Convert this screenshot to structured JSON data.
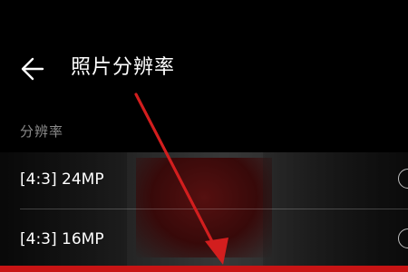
{
  "header": {
    "title": "照片分辨率",
    "back_icon": "arrow-left-icon"
  },
  "section": {
    "label": "分辨率"
  },
  "options": [
    {
      "label": "[4:3] 24MP",
      "selected": false
    },
    {
      "label": "[4:3] 16MP",
      "selected": false
    }
  ],
  "colors": {
    "background": "#000000",
    "annotation": "#d21e1e",
    "selected_highlight": "#c81414",
    "section_label": "#8a8a8a"
  }
}
